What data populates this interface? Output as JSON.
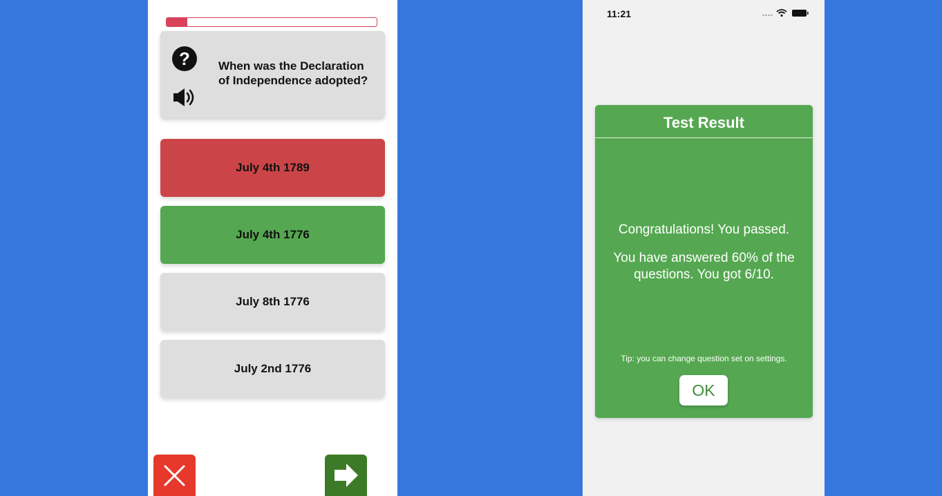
{
  "quiz": {
    "progress_fraction": 0.1,
    "question": "When was the Declaration of Independence adopted?",
    "answers": [
      {
        "label": "July 4th 1789",
        "state": "wrong"
      },
      {
        "label": "July 4th 1776",
        "state": "correct"
      },
      {
        "label": "July 8th 1776",
        "state": "neutral"
      },
      {
        "label": "July 2nd 1776",
        "state": "neutral"
      }
    ],
    "icons": {
      "help": "question-circle-icon",
      "speaker": "speaker-icon",
      "close": "close-icon",
      "next": "arrow-right-icon"
    },
    "colors": {
      "wrong": "#cb4548",
      "correct": "#55a851",
      "progress": "#d8435b",
      "close_button": "#e6392b",
      "next_button": "#3d7a27"
    }
  },
  "result": {
    "status_time": "11:21",
    "title": "Test Result",
    "congrats": "Congratulations! You passed.",
    "score_text": "You have answered 60% of the questions. You got 6/10.",
    "tip": "Tip: you can change question set on settings.",
    "ok_label": "OK",
    "colors": {
      "panel": "#55a851",
      "ok_text": "#3e8e3a"
    }
  }
}
